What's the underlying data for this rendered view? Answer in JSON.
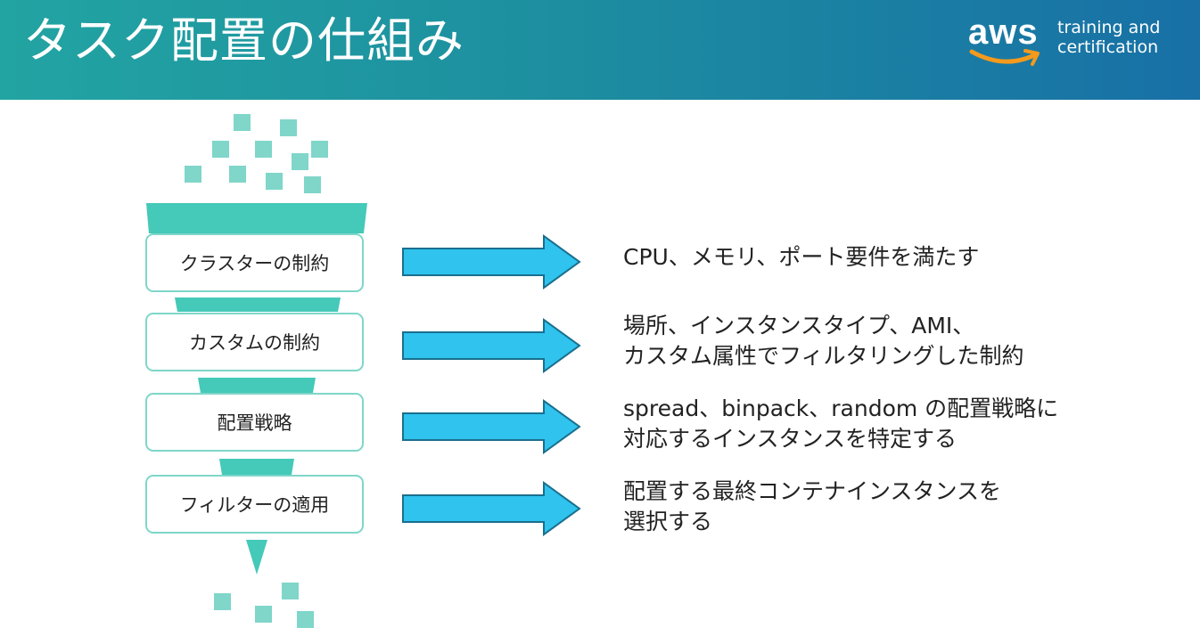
{
  "header": {
    "title": "タスク配置の仕組み",
    "logo_word": "aws",
    "logo_line1": "training and",
    "logo_line2": "certification"
  },
  "stages": [
    {
      "label": "クラスターの制約",
      "desc": [
        "CPU、メモリ、ポート要件を満たす"
      ]
    },
    {
      "label": "カスタムの制約",
      "desc": [
        "場所、インスタンスタイプ、AMI、",
        "カスタム属性でフィルタリングした制約"
      ]
    },
    {
      "label": "配置戦略",
      "desc": [
        "spread、binpack、random の配置戦略に",
        "対応するインスタンスを特定する"
      ]
    },
    {
      "label": "フィルターの適用",
      "desc": [
        "配置する最終コンテナインスタンスを",
        "選択する"
      ]
    }
  ],
  "colors": {
    "header_start": "#22a4a2",
    "header_end": "#1870a6",
    "accent_teal": "#7fd6c9",
    "funnel_teal": "#45c9b8",
    "arrow_blue": "#2fc3ee",
    "logo_smile": "#f49a1c"
  }
}
